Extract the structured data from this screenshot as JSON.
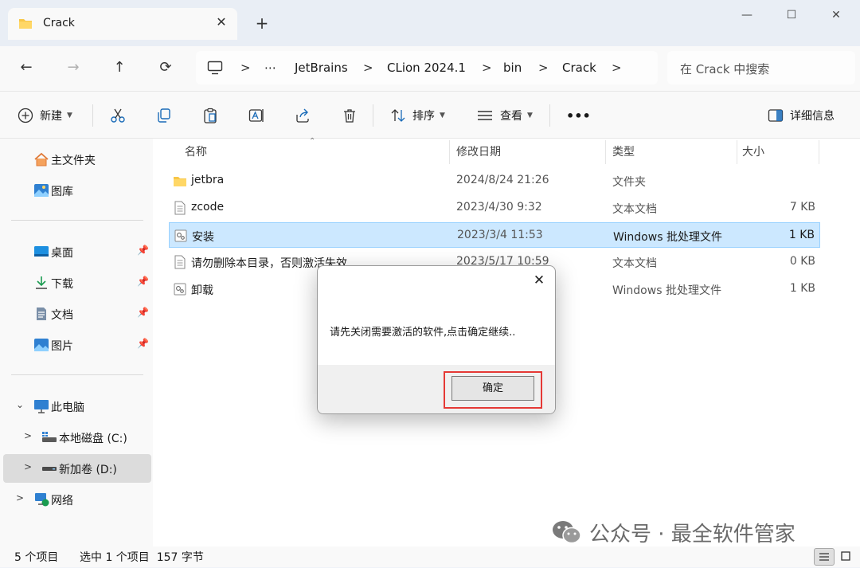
{
  "window": {
    "tab_title": "Crack",
    "new_tab": "+",
    "controls": {
      "minimize": "—",
      "maximize": "☐",
      "close": "✕"
    }
  },
  "nav": {
    "back": "←",
    "forward": "→",
    "up": "↑",
    "refresh": "⟳",
    "ellipsis": "⋯",
    "breadcrumbs": [
      "JetBrains",
      "CLion 2024.1",
      "bin",
      "Crack"
    ],
    "separator": ">",
    "search_placeholder": "在 Crack 中搜索"
  },
  "toolbar": {
    "new_label": "新建",
    "sort_label": "排序",
    "view_label": "查看",
    "more": "•••",
    "details_label": "详细信息"
  },
  "sidebar": {
    "top_items": [
      {
        "label": "主文件夹",
        "icon": "home-icon"
      },
      {
        "label": "图库",
        "icon": "gallery-icon"
      }
    ],
    "quick_access": [
      {
        "label": "桌面",
        "icon": "desktop-icon"
      },
      {
        "label": "下载",
        "icon": "download-icon"
      },
      {
        "label": "文档",
        "icon": "documents-icon"
      },
      {
        "label": "图片",
        "icon": "pictures-icon"
      }
    ],
    "pin": "📌",
    "tree": [
      {
        "label": "此电脑",
        "icon": "computer-icon",
        "chevron": "⌄"
      },
      {
        "label": "本地磁盘 (C:)",
        "icon": "drive-c-icon",
        "chevron": ">"
      },
      {
        "label": "新加卷 (D:)",
        "icon": "drive-d-icon",
        "chevron": ">",
        "selected": true
      },
      {
        "label": "网络",
        "icon": "network-icon",
        "chevron": ">"
      }
    ]
  },
  "columns": {
    "name": "名称",
    "date": "修改日期",
    "type": "类型",
    "size": "大小"
  },
  "files": [
    {
      "name": "jetbra",
      "date": "2024/8/24 21:26",
      "type": "文件夹",
      "size": "",
      "icon": "folder-icon"
    },
    {
      "name": "zcode",
      "date": "2023/4/30 9:32",
      "type": "文本文档",
      "size": "7 KB",
      "icon": "text-file-icon"
    },
    {
      "name": "安装",
      "date": "2023/3/4 11:53",
      "type": "Windows 批处理文件",
      "size": "1 KB",
      "icon": "batch-file-icon",
      "selected": true
    },
    {
      "name": "请勿删除本目录，否则激活失效",
      "date": "2023/5/17 10:59",
      "type": "文本文档",
      "size": "0 KB",
      "icon": "text-file-icon"
    },
    {
      "name": "卸载",
      "date": "",
      "type": "Windows 批处理文件",
      "size": "1 KB",
      "icon": "batch-file-icon"
    }
  ],
  "status": {
    "count": "5 个项目",
    "selection": "选中 1 个项目  157 字节"
  },
  "dialog": {
    "close": "✕",
    "message": "请先关闭需要激活的软件,点击确定继续..",
    "ok_label": "确定",
    "highlight_color": "#e53935"
  },
  "watermark": {
    "text": "公众号 · 最全软件管家"
  },
  "colors": {
    "selection": "#cce8ff",
    "accent": "#0067c0",
    "folder": "#f8c647"
  }
}
